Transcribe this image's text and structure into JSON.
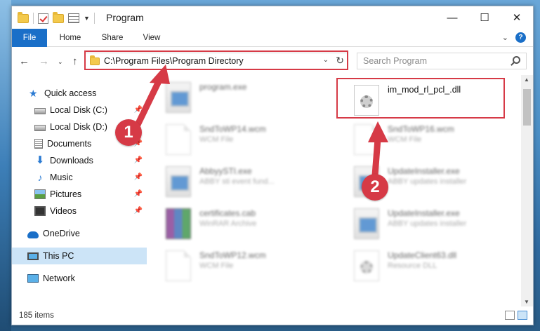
{
  "window": {
    "title": "Program"
  },
  "ribbon": {
    "tabs": [
      "File",
      "Home",
      "Share",
      "View"
    ]
  },
  "address": {
    "path": "C:\\Program Files\\Program Directory",
    "search_placeholder": "Search Program"
  },
  "sidebar": {
    "items": [
      {
        "label": "Quick access",
        "icon": "star-icon",
        "pinned": false
      },
      {
        "label": "Local Disk (C:)",
        "icon": "disk-icon",
        "pinned": true
      },
      {
        "label": "Local Disk (D:)",
        "icon": "disk-icon",
        "pinned": false
      },
      {
        "label": "Documents",
        "icon": "documents-icon",
        "pinned": true
      },
      {
        "label": "Downloads",
        "icon": "download-icon",
        "pinned": true
      },
      {
        "label": "Music",
        "icon": "music-icon",
        "pinned": true
      },
      {
        "label": "Pictures",
        "icon": "pictures-icon",
        "pinned": true
      },
      {
        "label": "Videos",
        "icon": "videos-icon",
        "pinned": true
      },
      {
        "label": "OneDrive",
        "icon": "onedrive-icon",
        "pinned": false
      },
      {
        "label": "This PC",
        "icon": "this-pc-icon",
        "pinned": false,
        "selected": true
      },
      {
        "label": "Network",
        "icon": "network-icon",
        "pinned": false
      }
    ]
  },
  "files": [
    {
      "name": "program.exe",
      "desc": "",
      "type": "exe"
    },
    {
      "name": "im_mod_rl_pcl_.dll",
      "desc": "",
      "type": "dll"
    },
    {
      "name": "SndToWP14.wcm",
      "desc": "WCM File",
      "type": "doc"
    },
    {
      "name": "SndToWP16.wcm",
      "desc": "WCM File",
      "type": "doc"
    },
    {
      "name": "AbbyySTI.exe",
      "desc": "ABBY sti event fund...",
      "type": "exe"
    },
    {
      "name": "UpdateInstaller.exe",
      "desc": "ABBY updates installer",
      "type": "exe"
    },
    {
      "name": "certificates.cab",
      "desc": "WinRAR Archive",
      "type": "cab"
    },
    {
      "name": "UpdateInstaller.exe",
      "desc": "ABBY updates installer",
      "type": "exe"
    },
    {
      "name": "SndToWP12.wcm",
      "desc": "WCM File",
      "type": "doc"
    },
    {
      "name": "UpdateClient63.dll",
      "desc": "Resource DLL",
      "type": "dll"
    }
  ],
  "status": {
    "items_count": "185 items"
  },
  "annotations": {
    "step1": "1",
    "step2": "2",
    "highlight_color": "#d63a46"
  },
  "colors": {
    "accent": "#1a6fc8",
    "selected": "#cce4f7"
  }
}
